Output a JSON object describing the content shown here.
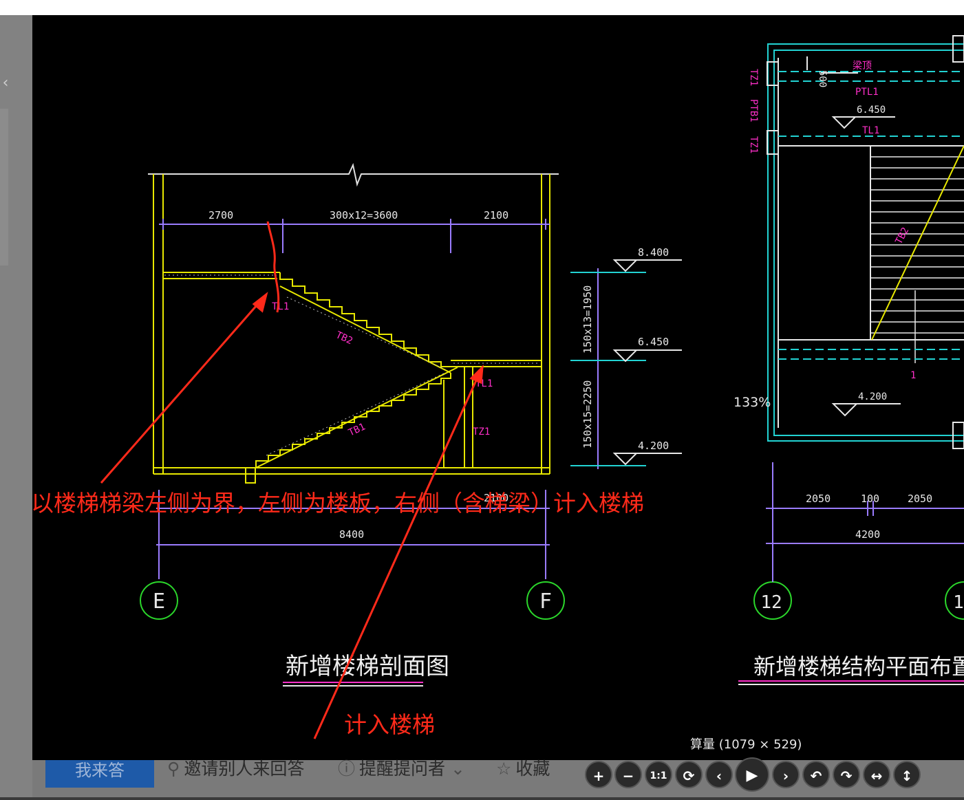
{
  "viewer": {
    "zoom_label": "133%",
    "caption": "算量 (1079 × 529)"
  },
  "drawing": {
    "left_title": "新增楼梯剖面图",
    "right_title": "新增楼梯结构平面布置图一",
    "dim_2700": "2700",
    "dim_3600": "300x12=3600",
    "dim_2100_top": "2100",
    "dim_2100_bottom": "2100",
    "dim_8400": "8400",
    "dim_1950": "150x13=1950",
    "dim_2250": "150x15=2250",
    "elev_8400": "8.400",
    "elev_6450": "6.450",
    "elev_4200": "4.200",
    "elev_6450_right": "6.450",
    "elev_4200_right": "4.200",
    "label_tl1": "TL1",
    "label_tb2": "TB2",
    "label_tb1": "TB1",
    "label_tz1": "TZ1",
    "label_tl1_b": "TL1",
    "axis_e": "E",
    "axis_f": "F",
    "axis_12": "12",
    "axis_13": "1",
    "right_dim_2050a": "2050",
    "right_dim_100": "100",
    "right_dim_2050b": "2050",
    "right_dim_4200": "4200",
    "right_dim_500": "500",
    "right_label_ptl1": "PTL1",
    "right_label_ptb1": "PTB1",
    "right_label_tz1a": "TZ1",
    "right_label_tz1b": "TZ1",
    "right_label_tl1": "TL1",
    "right_label_liangshang": "梁顶",
    "right_label_tb": "TB2",
    "right_label_1": "1"
  },
  "annotations": {
    "main": "以楼梯梯梁左侧为界，左侧为楼板，右侧（含梯梁）计入楼梯",
    "secondary": "计入楼梯"
  },
  "bottom": {
    "answer_button": "我来答",
    "invite": "邀请别人来回答",
    "remind": "提醒提问者",
    "collect": "收藏"
  },
  "controls": [
    "+",
    "−",
    "1:1",
    "⟳",
    "‹",
    "▶",
    "›",
    "↶",
    "↷",
    "↔",
    "↕"
  ]
}
